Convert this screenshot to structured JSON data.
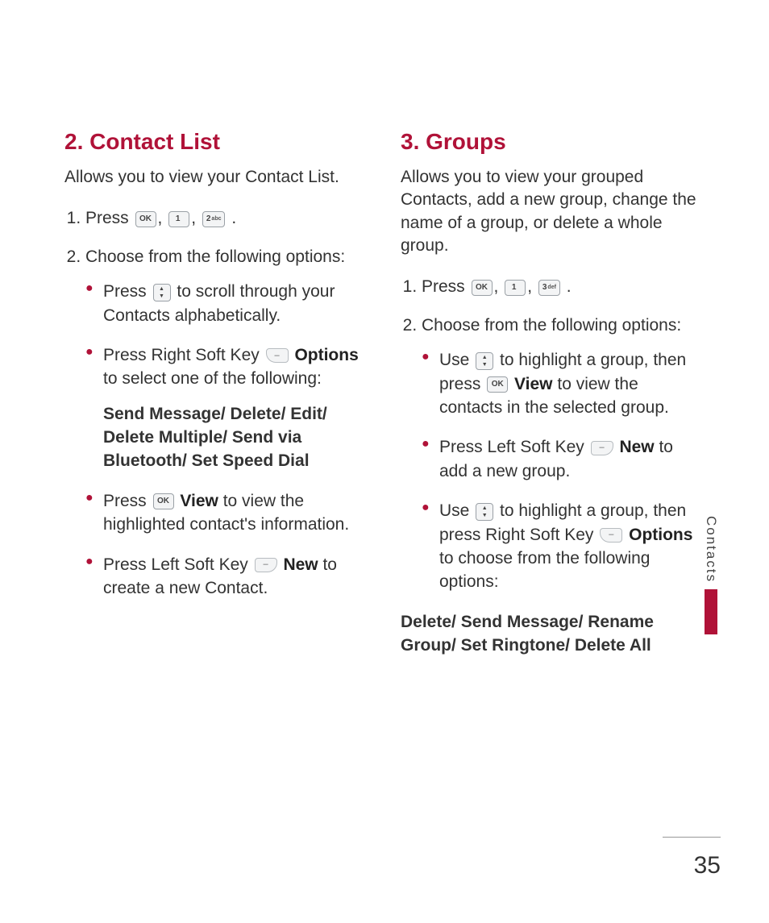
{
  "page_number": "35",
  "side_tab": "Contacts",
  "keys": {
    "ok": "OK",
    "k1_main": "1",
    "k2_main": "2",
    "k2_sub": "abc",
    "k3_main": "3",
    "k3_sub": "def",
    "soft_right": "–",
    "soft_left": "–"
  },
  "left": {
    "title": "2. Contact List",
    "intro": "Allows you to view your Contact List.",
    "step1_a": "Press ",
    "sep": ", ",
    "end": " .",
    "step2": "Choose from the following options:",
    "b1_a": "Press ",
    "b1_b": " to scroll through your Contacts alphabetically.",
    "b2_a": "Press Right Soft Key ",
    "b2_b_strong": "Options",
    "b2_c": " to select one of the following:",
    "b2_sub": "Send Message/ Delete/ Edit/ Delete Multiple/ Send via Bluetooth/ Set Speed Dial",
    "b3_a": "Press ",
    "b3_b_strong": "View",
    "b3_c": " to view the highlighted contact's information.",
    "b4_a": "Press Left Soft Key ",
    "b4_b_strong": "New",
    "b4_c": " to create a new Contact."
  },
  "right": {
    "title": "3. Groups",
    "intro": "Allows you to view your grouped Contacts, add a new group, change the name of a group, or delete a whole group.",
    "step1_a": "Press ",
    "sep": ", ",
    "end": " .",
    "step2": "Choose from the following options:",
    "b1_a": "Use ",
    "b1_b": " to highlight a group, then press ",
    "b1_c_strong": "View",
    "b1_d": " to view the contacts in the selected group.",
    "b2_a": "Press Left Soft Key ",
    "b2_b_strong": "New",
    "b2_c": " to add a new group.",
    "b3_a": "Use ",
    "b3_b": " to highlight a group, then press Right Soft Key ",
    "b3_c_strong": "Options",
    "b3_d": " to choose from the following options:",
    "after": "Delete/ Send Message/ Rename Group/ Set Ringtone/ Delete All"
  }
}
